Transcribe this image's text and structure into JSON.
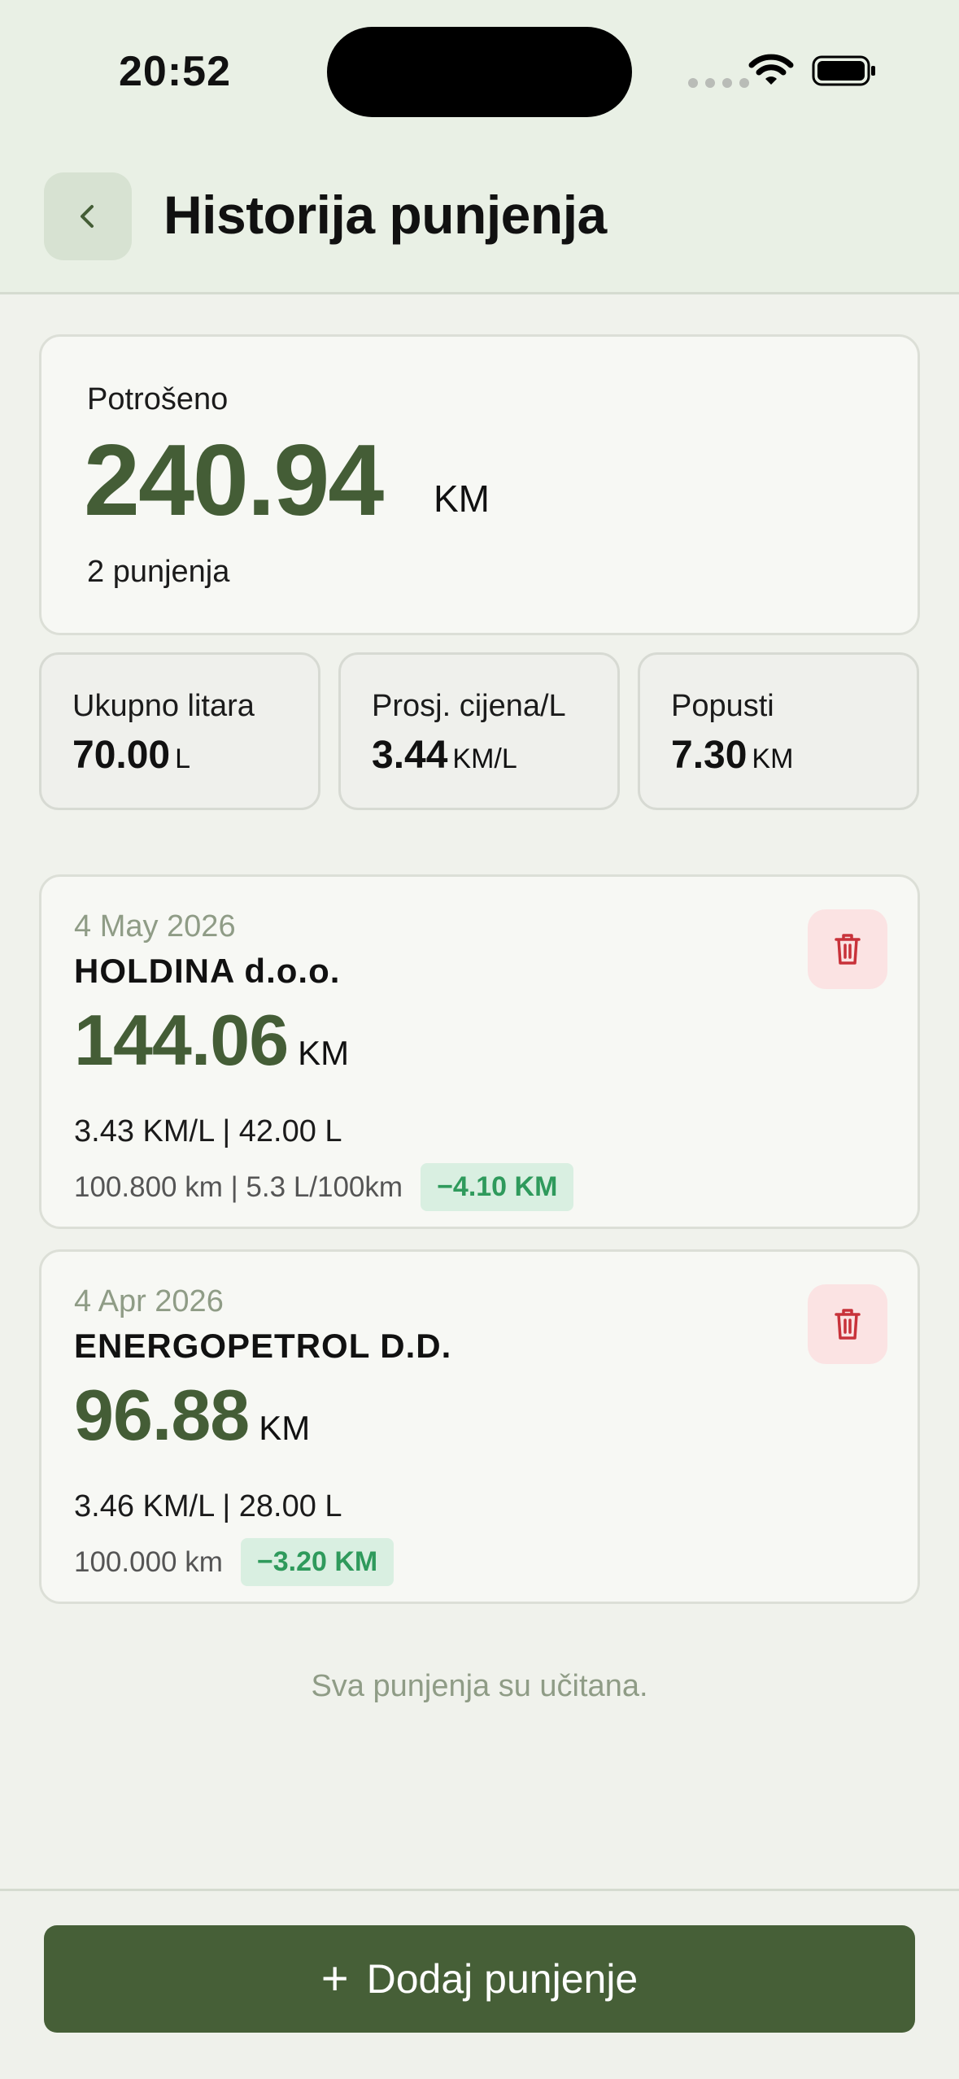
{
  "status_bar": {
    "time": "20:52"
  },
  "header": {
    "title": "Historija punjenja",
    "back_icon": "chevron-left-icon"
  },
  "summary": {
    "label": "Potrošeno",
    "value": "240.94",
    "unit": "KM",
    "count": "2 punjenja"
  },
  "stats": [
    {
      "label": "Ukupno litara",
      "value": "70.00",
      "unit": "L"
    },
    {
      "label": "Prosj. cijena/L",
      "value": "3.44",
      "unit": "KM/L"
    },
    {
      "label": "Popusti",
      "value": "7.30",
      "unit": "KM"
    }
  ],
  "entries": [
    {
      "date": "4 May 2026",
      "station": "HOLDINA d.o.o.",
      "amount": "144.06",
      "unit": "KM",
      "detail": "3.43 KM/L | 42.00 L",
      "meta": "100.800 km | 5.3 L/100km",
      "discount": "−4.10 KM"
    },
    {
      "date": "4 Apr 2026",
      "station": "ENERGOPETROL D.D.",
      "amount": "96.88",
      "unit": "KM",
      "detail": "3.46 KM/L | 28.00 L",
      "meta": "100.000 km",
      "discount": "−3.20 KM"
    }
  ],
  "footer_note": "Sva punjenja su učitana.",
  "add_button": {
    "label": "Dodaj punjenje",
    "icon": "plus-icon"
  },
  "colors": {
    "accent": "#465f37",
    "amount": "#445d36",
    "discount_text": "#2f9a5c",
    "discount_bg": "#d9efe1",
    "delete_bg": "#fbe3e3",
    "delete_icon": "#c8323a"
  }
}
